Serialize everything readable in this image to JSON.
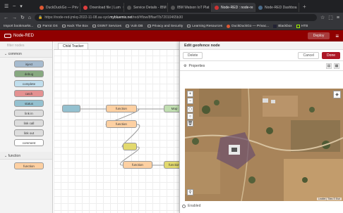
{
  "tabs": [
    {
      "label": "DuckDuckGo — Priv",
      "color": "#de5833"
    },
    {
      "label": "Download file | Lum",
      "color": "#e03e3e"
    },
    {
      "label": "Service Details - IBM",
      "color": "#555555"
    },
    {
      "label": "IBM Watson IoT Plat",
      "color": "#555555"
    },
    {
      "label": "Node-RED : node-re",
      "color": "#8f0000",
      "active": true
    },
    {
      "label": "Node-RED Dashboa",
      "color": "#4a6b8a"
    }
  ],
  "url": {
    "prefix": "https://node-red-jmkq-2022-11-08.au-syd.",
    "host": "mybluemix.net",
    "rest": "/red/#flow/8ffaef7b72010465b30"
  },
  "bookmarks": [
    "Import bookmarks...",
    "Parrot OS",
    "Hack The Box",
    "OSINT Services",
    "Vuln DB",
    "Privacy and Security",
    "Learning Resources",
    "DuckDuckGo — Privac...",
    "Blackbox",
    "HTB"
  ],
  "nodered": {
    "app_title": "Node-RED",
    "deploy_label": "Deploy"
  },
  "palette": {
    "filter_placeholder": "filter nodes",
    "category_common": "common",
    "common_nodes": [
      "inject",
      "debug",
      "complete",
      "catch",
      "status",
      "link in",
      "link call",
      "link out",
      "comment"
    ],
    "category_function": "function",
    "function_nodes": [
      "function"
    ]
  },
  "workspace": {
    "tab_label": "Child Tracker",
    "nodes": [
      "",
      "function",
      "function",
      "",
      "function",
      "function",
      "Map"
    ]
  },
  "tray": {
    "title": "Edit geofence node",
    "delete_label": "Delete",
    "cancel_label": "Cancel",
    "done_label": "Done",
    "properties_label": "Properties",
    "enabled_label": "Enabled",
    "map_attribution": "Leaflet | Tiles © Esri"
  },
  "colors": {
    "nodered_red": "#8f0000",
    "done_button": "#ad1625",
    "palette_common_node": "#a6bbcf",
    "palette_catch_node": "#e49191",
    "function_node": "#fdd0a2"
  }
}
